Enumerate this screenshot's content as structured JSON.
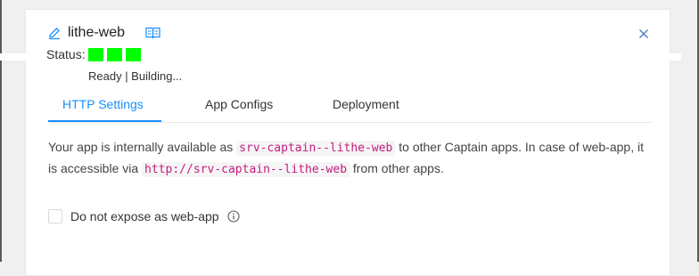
{
  "app": {
    "name": "lithe-web",
    "status_label": "Status:",
    "status_caption": "Ready | Building...",
    "status_color": "#00ff00"
  },
  "tabs": [
    {
      "label": "HTTP Settings",
      "active": true
    },
    {
      "label": "App Configs",
      "active": false
    },
    {
      "label": "Deployment",
      "active": false
    }
  ],
  "http": {
    "text_1": "Your app is internally available as ",
    "internal_host": "srv-captain--lithe-web",
    "text_2": " to other Captain apps. In case of web-app, it is accessible via ",
    "internal_url": "http://srv-captain--lithe-web",
    "text_3": " from other apps.",
    "expose_label": "Do not expose as web-app",
    "expose_checked": false
  },
  "icons": {
    "edit": "pencil-icon",
    "docs": "book-icon",
    "close": "close-icon",
    "info": "info-icon"
  },
  "colors": {
    "accent": "#1890ff",
    "code_text": "#c41d7f",
    "status_green": "#00ff00"
  }
}
